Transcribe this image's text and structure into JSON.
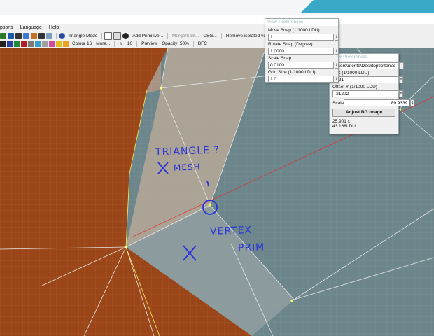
{
  "menu": {
    "options": "ptions",
    "language": "Language",
    "help": "Help"
  },
  "toolbar1": {
    "triangle_mode": "Triangle Mode",
    "add_primitive": "Add Primitive...",
    "merge_split": "Merge/Split...",
    "csg": "CSG...",
    "remove_isolated": "Remove isolated vertices"
  },
  "toolbar2": {
    "colour": "Colour 16",
    "more": "More...",
    "count": "16",
    "preview": "Preview",
    "opacity": "Opacity: 50%",
    "bfc": "BFC"
  },
  "colors": {
    "swatches": [
      "#222222",
      "#2b3fa0",
      "#1f8a3a",
      "#b02020",
      "#7a7a7a",
      "#3aa0c8",
      "#a0a0a0",
      "#d44a9a",
      "#e0c020",
      "#f0a020"
    ]
  },
  "view_prefs": {
    "title": "View-Preferences",
    "move_snap_label": "Move Snap (1/1000 LDU)",
    "move_snap_value": "1",
    "rotate_snap_label": "Rotate Snap (Degree)",
    "rotate_snap_value": "1.0000",
    "scale_snap_label": "Scale Snap",
    "scale_snap_value": "0.0100",
    "grid_size_label": "Grid Size (1/1000 LDU)",
    "grid_size_value": "1.0"
  },
  "bg_prefs": {
    "title": "View-Preferences",
    "path_value": "Users\\utente\\Desktop\\lotten\\S",
    "offset_x_label": "et X (1/1000 LDU)",
    "offset_x_value": "-521",
    "offset_y_label": "Offset Y (1/1000 LDU)",
    "offset_y_value": "-21202",
    "scale_label": "Scale",
    "scale_value": "89.9339",
    "adjust_button": "Adjust BG Image",
    "dims_1": "25.901 x",
    "dims_2": "43.168LDU"
  },
  "annotations": {
    "triangle": "TRIANGLE ?",
    "mesh": "MESH",
    "vertex": "VERTEX",
    "prim": "PRIM"
  }
}
